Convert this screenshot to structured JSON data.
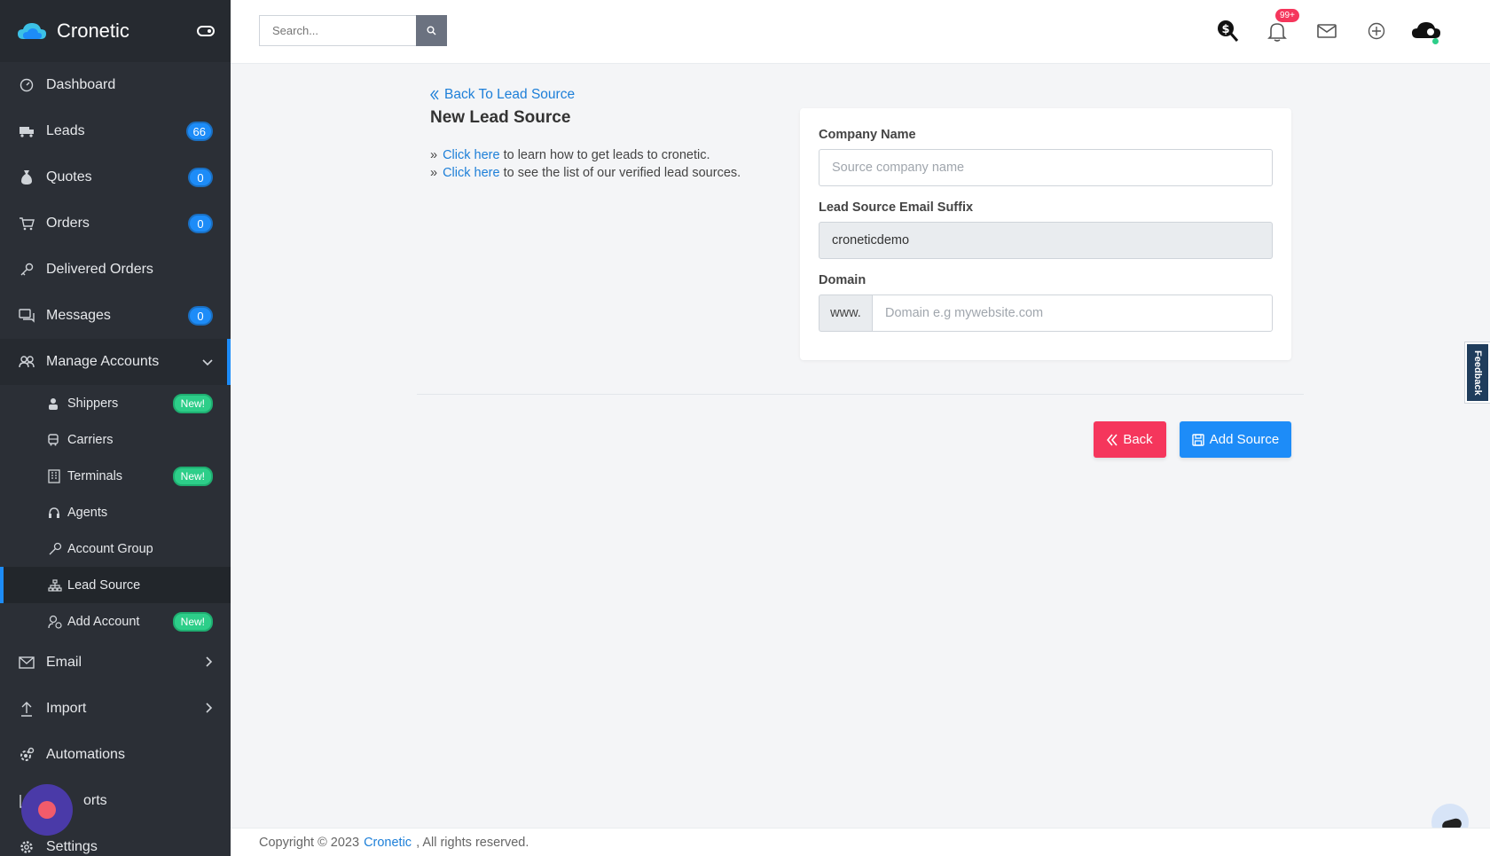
{
  "brand": {
    "name": "Cronetic"
  },
  "search": {
    "placeholder": "Search..."
  },
  "nav": {
    "dashboard": "Dashboard",
    "leads": {
      "label": "Leads",
      "count": "66"
    },
    "quotes": {
      "label": "Quotes",
      "count": "0"
    },
    "orders": {
      "label": "Orders",
      "count": "0"
    },
    "delivered": "Delivered Orders",
    "messages": {
      "label": "Messages",
      "count": "0"
    },
    "manage_accounts": "Manage Accounts",
    "sub": {
      "shippers": {
        "label": "Shippers",
        "badge": "New!"
      },
      "carriers": "Carriers",
      "terminals": {
        "label": "Terminals",
        "badge": "New!"
      },
      "agents": "Agents",
      "account_group": "Account Group",
      "lead_source": "Lead Source",
      "add_account": {
        "label": "Add Account",
        "badge": "New!"
      }
    },
    "email": "Email",
    "import": "Import",
    "automations": "Automations",
    "reports": "orts",
    "settings": "Settings"
  },
  "topbar": {
    "notif_count": "99+"
  },
  "page": {
    "back_link": "Back To Lead Source",
    "title": "New Lead Source",
    "info": [
      {
        "link": "Click here",
        "text": " to learn how to get leads to cronetic."
      },
      {
        "link": "Click here",
        "text": " to see the list of our verified lead sources."
      }
    ]
  },
  "form": {
    "company_label": "Company Name",
    "company_placeholder": "Source company name",
    "suffix_label": "Lead Source Email Suffix",
    "suffix_value": "croneticdemo",
    "domain_label": "Domain",
    "domain_prefix": "www.",
    "domain_placeholder": "Domain e.g mywebsite.com"
  },
  "actions": {
    "back": "Back",
    "add": "Add Source"
  },
  "feedback": "Feedback",
  "footer": {
    "prefix": "Copyright © 2023",
    "brand": "Cronetic",
    "suffix": ", All rights reserved."
  },
  "colors": {
    "accent": "#1d8cf8",
    "danger": "#f5365c",
    "success": "#2dce89",
    "sidebar": "#2b2f36"
  }
}
